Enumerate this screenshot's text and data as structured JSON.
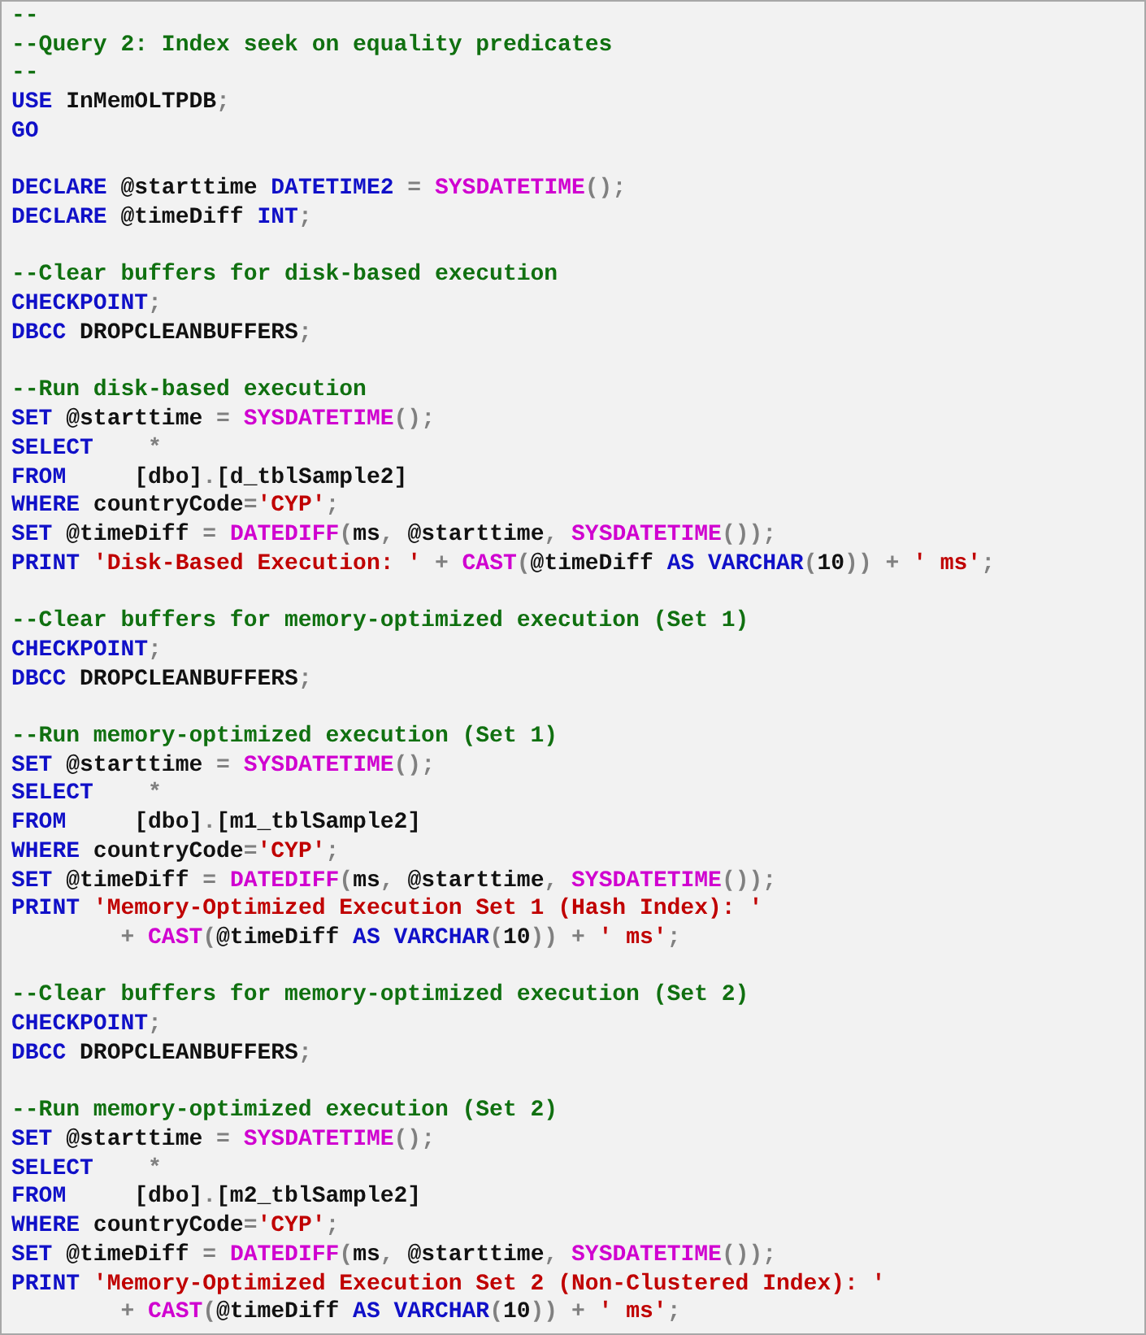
{
  "editor": {
    "blocks": [
      {
        "lines": [
          {
            "tokens": [
              {
                "kind": "comment",
                "text": "--"
              }
            ]
          },
          {
            "tokens": [
              {
                "kind": "comment",
                "text": "--Query 2: Index seek on equality predicates"
              }
            ]
          },
          {
            "tokens": [
              {
                "kind": "comment",
                "text": "--"
              }
            ]
          },
          {
            "tokens": [
              {
                "kind": "keyword",
                "text": "USE"
              },
              {
                "kind": "plain",
                "text": " InMemOLTPDB"
              },
              {
                "kind": "operator",
                "text": ";"
              }
            ]
          },
          {
            "tokens": [
              {
                "kind": "keyword",
                "text": "GO"
              }
            ]
          }
        ]
      },
      {
        "lines": [
          {
            "tokens": [
              {
                "kind": "keyword",
                "text": "DECLARE"
              },
              {
                "kind": "plain",
                "text": " @starttime "
              },
              {
                "kind": "keyword",
                "text": "DATETIME2"
              },
              {
                "kind": "operator",
                "text": " = "
              },
              {
                "kind": "function",
                "text": "SYSDATETIME"
              },
              {
                "kind": "operator",
                "text": "();"
              }
            ]
          },
          {
            "tokens": [
              {
                "kind": "keyword",
                "text": "DECLARE"
              },
              {
                "kind": "plain",
                "text": " @timeDiff "
              },
              {
                "kind": "keyword",
                "text": "INT"
              },
              {
                "kind": "operator",
                "text": ";"
              }
            ]
          }
        ]
      },
      {
        "lines": [
          {
            "tokens": [
              {
                "kind": "comment",
                "text": "--Clear buffers for disk-based execution"
              }
            ]
          },
          {
            "tokens": [
              {
                "kind": "keyword",
                "text": "CHECKPOINT"
              },
              {
                "kind": "operator",
                "text": ";"
              }
            ]
          },
          {
            "tokens": [
              {
                "kind": "keyword",
                "text": "DBCC"
              },
              {
                "kind": "plain",
                "text": " DROPCLEANBUFFERS"
              },
              {
                "kind": "operator",
                "text": ";"
              }
            ]
          }
        ]
      },
      {
        "lines": [
          {
            "tokens": [
              {
                "kind": "comment",
                "text": "--Run disk-based execution"
              }
            ]
          },
          {
            "tokens": [
              {
                "kind": "keyword",
                "text": "SET"
              },
              {
                "kind": "plain",
                "text": " @starttime "
              },
              {
                "kind": "operator",
                "text": "= "
              },
              {
                "kind": "function",
                "text": "SYSDATETIME"
              },
              {
                "kind": "operator",
                "text": "();"
              }
            ]
          },
          {
            "tokens": [
              {
                "kind": "keyword",
                "text": "SELECT"
              },
              {
                "kind": "operator",
                "text": "    *"
              }
            ]
          },
          {
            "tokens": [
              {
                "kind": "keyword",
                "text": "FROM"
              },
              {
                "kind": "plain",
                "text": "     [dbo]"
              },
              {
                "kind": "operator",
                "text": "."
              },
              {
                "kind": "plain",
                "text": "[d_tblSample2]"
              }
            ]
          },
          {
            "tokens": [
              {
                "kind": "keyword",
                "text": "WHERE"
              },
              {
                "kind": "plain",
                "text": " countryCode"
              },
              {
                "kind": "operator",
                "text": "="
              },
              {
                "kind": "string",
                "text": "'CYP'"
              },
              {
                "kind": "operator",
                "text": ";"
              }
            ]
          },
          {
            "tokens": [
              {
                "kind": "keyword",
                "text": "SET"
              },
              {
                "kind": "plain",
                "text": " @timeDiff "
              },
              {
                "kind": "operator",
                "text": "= "
              },
              {
                "kind": "function",
                "text": "DATEDIFF"
              },
              {
                "kind": "operator",
                "text": "("
              },
              {
                "kind": "plain",
                "text": "ms"
              },
              {
                "kind": "operator",
                "text": ", "
              },
              {
                "kind": "plain",
                "text": "@starttime"
              },
              {
                "kind": "operator",
                "text": ", "
              },
              {
                "kind": "function",
                "text": "SYSDATETIME"
              },
              {
                "kind": "operator",
                "text": "());"
              }
            ]
          },
          {
            "tokens": [
              {
                "kind": "keyword",
                "text": "PRINT "
              },
              {
                "kind": "string",
                "text": "'Disk-Based Execution: '"
              },
              {
                "kind": "operator",
                "text": " + "
              },
              {
                "kind": "function",
                "text": "CAST"
              },
              {
                "kind": "operator",
                "text": "("
              },
              {
                "kind": "plain",
                "text": "@timeDiff "
              },
              {
                "kind": "keyword",
                "text": "AS VARCHAR"
              },
              {
                "kind": "operator",
                "text": "("
              },
              {
                "kind": "plain",
                "text": "10"
              },
              {
                "kind": "operator",
                "text": ")) + "
              },
              {
                "kind": "string",
                "text": "' ms'"
              },
              {
                "kind": "operator",
                "text": ";"
              }
            ]
          }
        ]
      },
      {
        "lines": [
          {
            "tokens": [
              {
                "kind": "comment",
                "text": "--Clear buffers for memory-optimized execution (Set 1)"
              }
            ]
          },
          {
            "tokens": [
              {
                "kind": "keyword",
                "text": "CHECKPOINT"
              },
              {
                "kind": "operator",
                "text": ";"
              }
            ]
          },
          {
            "tokens": [
              {
                "kind": "keyword",
                "text": "DBCC"
              },
              {
                "kind": "plain",
                "text": " DROPCLEANBUFFERS"
              },
              {
                "kind": "operator",
                "text": ";"
              }
            ]
          }
        ]
      },
      {
        "lines": [
          {
            "tokens": [
              {
                "kind": "comment",
                "text": "--Run memory-optimized execution (Set 1)"
              }
            ]
          },
          {
            "tokens": [
              {
                "kind": "keyword",
                "text": "SET"
              },
              {
                "kind": "plain",
                "text": " @starttime "
              },
              {
                "kind": "operator",
                "text": "= "
              },
              {
                "kind": "function",
                "text": "SYSDATETIME"
              },
              {
                "kind": "operator",
                "text": "();"
              }
            ]
          },
          {
            "tokens": [
              {
                "kind": "keyword",
                "text": "SELECT"
              },
              {
                "kind": "operator",
                "text": "    *"
              }
            ]
          },
          {
            "tokens": [
              {
                "kind": "keyword",
                "text": "FROM"
              },
              {
                "kind": "plain",
                "text": "     [dbo]"
              },
              {
                "kind": "operator",
                "text": "."
              },
              {
                "kind": "plain",
                "text": "[m1_tblSample2]"
              }
            ]
          },
          {
            "tokens": [
              {
                "kind": "keyword",
                "text": "WHERE"
              },
              {
                "kind": "plain",
                "text": " countryCode"
              },
              {
                "kind": "operator",
                "text": "="
              },
              {
                "kind": "string",
                "text": "'CYP'"
              },
              {
                "kind": "operator",
                "text": ";"
              }
            ]
          },
          {
            "tokens": [
              {
                "kind": "keyword",
                "text": "SET"
              },
              {
                "kind": "plain",
                "text": " @timeDiff "
              },
              {
                "kind": "operator",
                "text": "= "
              },
              {
                "kind": "function",
                "text": "DATEDIFF"
              },
              {
                "kind": "operator",
                "text": "("
              },
              {
                "kind": "plain",
                "text": "ms"
              },
              {
                "kind": "operator",
                "text": ", "
              },
              {
                "kind": "plain",
                "text": "@starttime"
              },
              {
                "kind": "operator",
                "text": ", "
              },
              {
                "kind": "function",
                "text": "SYSDATETIME"
              },
              {
                "kind": "operator",
                "text": "());"
              }
            ]
          },
          {
            "tokens": [
              {
                "kind": "keyword",
                "text": "PRINT "
              },
              {
                "kind": "string",
                "text": "'Memory-Optimized Execution Set 1 (Hash Index): '"
              }
            ]
          },
          {
            "tokens": [
              {
                "kind": "operator",
                "text": "        + "
              },
              {
                "kind": "function",
                "text": "CAST"
              },
              {
                "kind": "operator",
                "text": "("
              },
              {
                "kind": "plain",
                "text": "@timeDiff "
              },
              {
                "kind": "keyword",
                "text": "AS VARCHAR"
              },
              {
                "kind": "operator",
                "text": "("
              },
              {
                "kind": "plain",
                "text": "10"
              },
              {
                "kind": "operator",
                "text": ")) + "
              },
              {
                "kind": "string",
                "text": "' ms'"
              },
              {
                "kind": "operator",
                "text": ";"
              }
            ]
          }
        ]
      },
      {
        "lines": [
          {
            "tokens": [
              {
                "kind": "comment",
                "text": "--Clear buffers for memory-optimized execution (Set 2)"
              }
            ]
          },
          {
            "tokens": [
              {
                "kind": "keyword",
                "text": "CHECKPOINT"
              },
              {
                "kind": "operator",
                "text": ";"
              }
            ]
          },
          {
            "tokens": [
              {
                "kind": "keyword",
                "text": "DBCC"
              },
              {
                "kind": "plain",
                "text": " DROPCLEANBUFFERS"
              },
              {
                "kind": "operator",
                "text": ";"
              }
            ]
          }
        ]
      },
      {
        "lines": [
          {
            "tokens": [
              {
                "kind": "comment",
                "text": "--Run memory-optimized execution (Set 2)"
              }
            ]
          },
          {
            "tokens": [
              {
                "kind": "keyword",
                "text": "SET"
              },
              {
                "kind": "plain",
                "text": " @starttime "
              },
              {
                "kind": "operator",
                "text": "= "
              },
              {
                "kind": "function",
                "text": "SYSDATETIME"
              },
              {
                "kind": "operator",
                "text": "();"
              }
            ]
          },
          {
            "tokens": [
              {
                "kind": "keyword",
                "text": "SELECT"
              },
              {
                "kind": "operator",
                "text": "    *"
              }
            ]
          },
          {
            "tokens": [
              {
                "kind": "keyword",
                "text": "FROM"
              },
              {
                "kind": "plain",
                "text": "     [dbo]"
              },
              {
                "kind": "operator",
                "text": "."
              },
              {
                "kind": "plain",
                "text": "[m2_tblSample2]"
              }
            ]
          },
          {
            "tokens": [
              {
                "kind": "keyword",
                "text": "WHERE"
              },
              {
                "kind": "plain",
                "text": " countryCode"
              },
              {
                "kind": "operator",
                "text": "="
              },
              {
                "kind": "string",
                "text": "'CYP'"
              },
              {
                "kind": "operator",
                "text": ";"
              }
            ]
          },
          {
            "tokens": [
              {
                "kind": "keyword",
                "text": "SET"
              },
              {
                "kind": "plain",
                "text": " @timeDiff "
              },
              {
                "kind": "operator",
                "text": "= "
              },
              {
                "kind": "function",
                "text": "DATEDIFF"
              },
              {
                "kind": "operator",
                "text": "("
              },
              {
                "kind": "plain",
                "text": "ms"
              },
              {
                "kind": "operator",
                "text": ", "
              },
              {
                "kind": "plain",
                "text": "@starttime"
              },
              {
                "kind": "operator",
                "text": ", "
              },
              {
                "kind": "function",
                "text": "SYSDATETIME"
              },
              {
                "kind": "operator",
                "text": "());"
              }
            ]
          },
          {
            "tokens": [
              {
                "kind": "keyword",
                "text": "PRINT "
              },
              {
                "kind": "string",
                "text": "'Memory-Optimized Execution Set 2 (Non-Clustered Index): '"
              }
            ]
          },
          {
            "tokens": [
              {
                "kind": "operator",
                "text": "        + "
              },
              {
                "kind": "function",
                "text": "CAST"
              },
              {
                "kind": "operator",
                "text": "("
              },
              {
                "kind": "plain",
                "text": "@timeDiff "
              },
              {
                "kind": "keyword",
                "text": "AS VARCHAR"
              },
              {
                "kind": "operator",
                "text": "("
              },
              {
                "kind": "plain",
                "text": "10"
              },
              {
                "kind": "operator",
                "text": ")) + "
              },
              {
                "kind": "string",
                "text": "' ms'"
              },
              {
                "kind": "operator",
                "text": ";"
              }
            ]
          }
        ]
      }
    ]
  }
}
